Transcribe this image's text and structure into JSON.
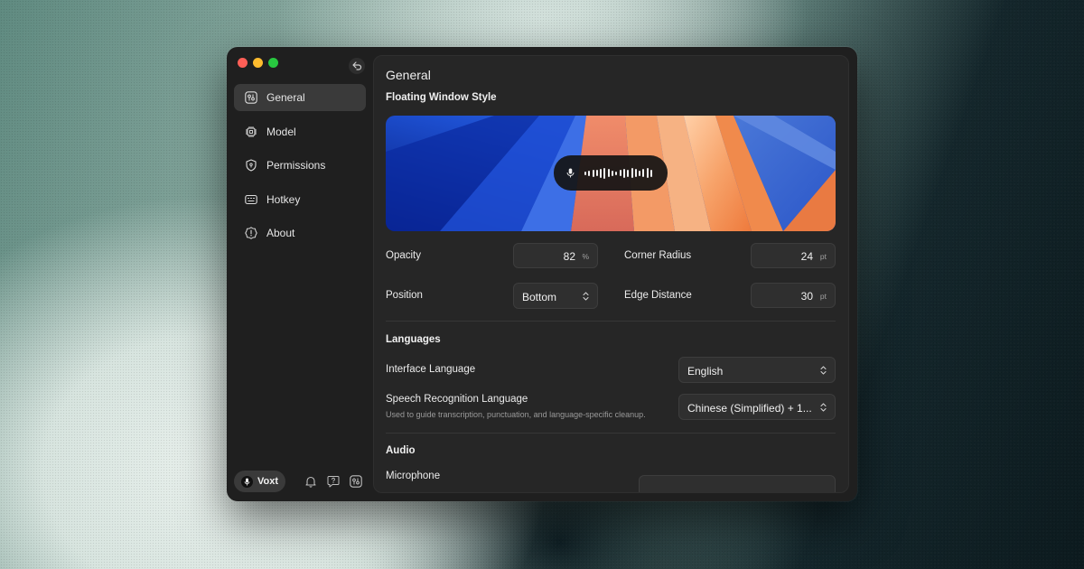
{
  "window": {
    "traffic_lights": [
      "close",
      "minimize",
      "zoom"
    ],
    "collapse_icon": "sidebar-back-icon"
  },
  "sidebar": {
    "items": [
      {
        "label": "General",
        "icon": "general-icon",
        "active": true
      },
      {
        "label": "Model",
        "icon": "chip-icon",
        "active": false
      },
      {
        "label": "Permissions",
        "icon": "shield-icon",
        "active": false
      },
      {
        "label": "Hotkey",
        "icon": "keyboard-icon",
        "active": false
      },
      {
        "label": "About",
        "icon": "info-icon",
        "active": false
      }
    ],
    "brand": {
      "label": "Voxt",
      "icon": "microphone-icon"
    },
    "bottom_icons": [
      "bell-icon",
      "help-icon",
      "general-icon"
    ]
  },
  "main": {
    "title": "General",
    "floating_window": {
      "section_title": "Floating Window Style",
      "preview_icon": "microphone-icon",
      "opacity": {
        "label": "Opacity",
        "value": "82",
        "unit": "%"
      },
      "corner_radius": {
        "label": "Corner Radius",
        "value": "24",
        "unit": "pt"
      },
      "position": {
        "label": "Position",
        "value": "Bottom"
      },
      "edge_distance": {
        "label": "Edge Distance",
        "value": "30",
        "unit": "pt"
      }
    },
    "languages": {
      "section_title": "Languages",
      "interface_language": {
        "label": "Interface Language",
        "value": "English"
      },
      "speech_recognition_language": {
        "label": "Speech Recognition Language",
        "description": "Used to guide transcription, punctuation, and language-specific cleanup.",
        "value": "Chinese (Simplified) + 1..."
      }
    },
    "audio": {
      "section_title": "Audio",
      "microphone": {
        "label": "Microphone"
      }
    }
  },
  "colors": {
    "window_bg": "#1f1f1f",
    "panel_bg": "#262626",
    "active_item": "#3a3a3a",
    "close": "#ff5f57",
    "minimize": "#febc2e",
    "zoom": "#28c840"
  }
}
